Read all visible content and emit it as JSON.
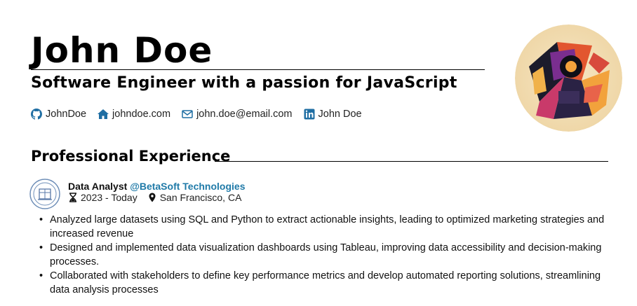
{
  "header": {
    "name": "John Doe",
    "tagline": "Software Engineer with a passion for JavaScript"
  },
  "contacts": {
    "github": "JohnDoe",
    "website": "johndoe.com",
    "email": "john.doe@email.com",
    "linkedin": "John Doe"
  },
  "experience": {
    "section_title": "Professional Experience",
    "role": "Data Analyst",
    "company": "@BetaSoft Technologies",
    "dates": "2023 - Today",
    "location": "San Francisco, CA",
    "bullets": [
      "Analyzed large datasets using SQL and Python to extract actionable insights, leading to optimized marketing strategies and increased revenue",
      "Designed and implemented data visualization dashboards using Tableau, improving data accessibility and decision-making processes.",
      "Collaborated with stakeholders to define key performance metrics and develop automated reporting solutions, streamlining data analysis processes"
    ]
  },
  "colors": {
    "accent": "#1f7aa8",
    "icon": "#1f6ea3"
  }
}
